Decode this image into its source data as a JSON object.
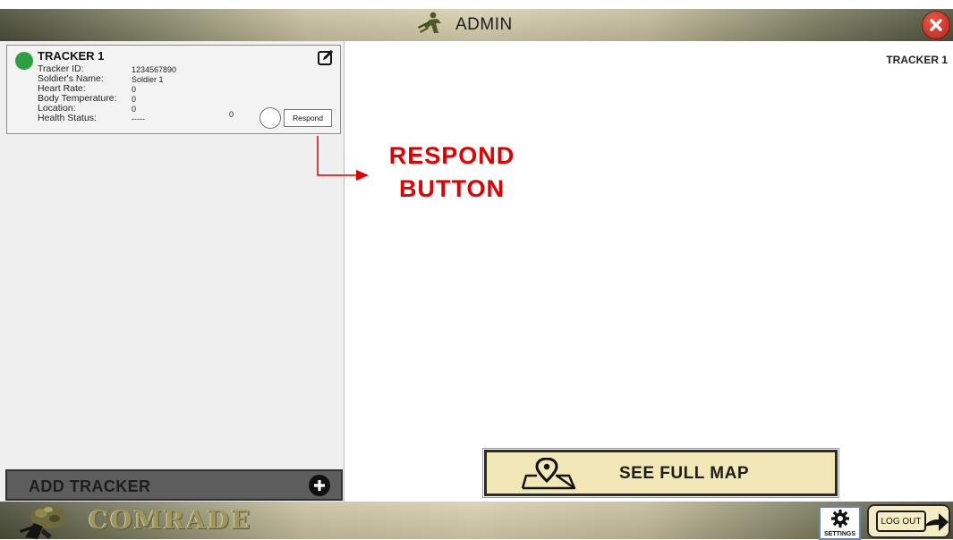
{
  "header": {
    "title": "ADMIN",
    "admin_icon": "soldier-icon",
    "close_icon": "close-icon"
  },
  "tracker_card": {
    "title": "TRACKER 1",
    "status_color": "#2ea043",
    "edit_icon": "edit-icon",
    "fields": [
      {
        "label": "Tracker ID:",
        "value": "1234567890"
      },
      {
        "label": "Soldier's Name:",
        "value": "Soldier 1"
      },
      {
        "label": "Heart Rate:",
        "value": "0"
      },
      {
        "label": "Body Temperature:",
        "value": "0"
      },
      {
        "label": "Location:",
        "value": "0"
      },
      {
        "label": "Health Status:",
        "value": "-----"
      }
    ],
    "location_extra": "0",
    "respond_label": "Respond"
  },
  "left_panel": {
    "add_tracker_label": "ADD TRACKER",
    "add_icon": "plus-icon"
  },
  "main": {
    "selected_tracker_label": "TRACKER 1",
    "annotation_line1": "RESPOND",
    "annotation_line2": "BUTTON",
    "annotation_color": "#e00000",
    "see_full_map_label": "SEE FULL MAP",
    "map_icon": "map-pin-icon"
  },
  "footer": {
    "brand_name": "COMRADE",
    "brand_icon": "soldier-logo-icon",
    "settings_label": "SETTINGS",
    "settings_icon": "gear-icon",
    "logout_label": "LOG OUT",
    "logout_icon": "arrow-right-icon"
  }
}
